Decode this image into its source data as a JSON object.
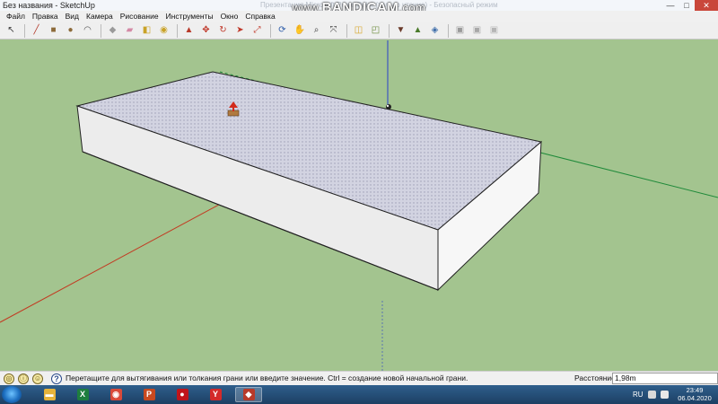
{
  "window": {
    "title": "Без названия - SketchUp",
    "faded_caption": "Презентация Microsoft PowerPoint (только чтение) - Безопасный режим",
    "controls": {
      "minimize": "—",
      "maximize": "□",
      "close": "✕"
    }
  },
  "watermark": {
    "prefix": "www.",
    "brand": "BANDICAM",
    "suffix": ".com"
  },
  "menu": [
    "Файл",
    "Правка",
    "Вид",
    "Камера",
    "Рисование",
    "Инструменты",
    "Окно",
    "Справка"
  ],
  "toolbar": {
    "tools": [
      {
        "name": "select-tool",
        "glyph": "↖",
        "color": "#3a3a3a"
      },
      {
        "name": "line-tool",
        "glyph": "╱",
        "color": "#b33a2a"
      },
      {
        "name": "rectangle-tool",
        "glyph": "■",
        "color": "#8c6a3a"
      },
      {
        "name": "circle-tool",
        "glyph": "●",
        "color": "#8c6a3a"
      },
      {
        "name": "arc-tool",
        "glyph": "◠",
        "color": "#555555"
      },
      {
        "name": "make-component-tool",
        "glyph": "◆",
        "color": "#9a9a9a"
      },
      {
        "name": "eraser-tool",
        "glyph": "▰",
        "color": "#d48aa6"
      },
      {
        "name": "tape-measure-tool",
        "glyph": "◧",
        "color": "#c9a227"
      },
      {
        "name": "paint-bucket-tool",
        "glyph": "◉",
        "color": "#c9a227"
      },
      {
        "name": "push-pull-tool",
        "glyph": "▲",
        "color": "#b83a2a"
      },
      {
        "name": "move-tool",
        "glyph": "✥",
        "color": "#c0392b"
      },
      {
        "name": "rotate-tool",
        "glyph": "↻",
        "color": "#c0392b"
      },
      {
        "name": "follow-me-tool",
        "glyph": "➤",
        "color": "#c0392b"
      },
      {
        "name": "scale-tool",
        "glyph": "⤢",
        "color": "#c0392b"
      },
      {
        "name": "orbit-tool",
        "glyph": "⟳",
        "color": "#2a5aa8"
      },
      {
        "name": "pan-tool",
        "glyph": "✋",
        "color": "#5a5a5a"
      },
      {
        "name": "zoom-tool",
        "glyph": "⌕",
        "color": "#3a3a3a"
      },
      {
        "name": "zoom-extents-tool",
        "glyph": "⤧",
        "color": "#3a3a3a"
      },
      {
        "name": "section-plane-tool",
        "glyph": "◫",
        "color": "#d6a52a"
      },
      {
        "name": "add-location-tool",
        "glyph": "◰",
        "color": "#6a8a3a"
      },
      {
        "name": "get-models-tool",
        "glyph": "▼",
        "color": "#6a3a2a"
      },
      {
        "name": "share-model-tool",
        "glyph": "▲",
        "color": "#4a7a2a"
      },
      {
        "name": "extension-warehouse-tool",
        "glyph": "◈",
        "color": "#3a6aa8"
      },
      {
        "name": "style-tool-1",
        "glyph": "▣",
        "color": "#9a9a9a"
      },
      {
        "name": "style-tool-2",
        "glyph": "▣",
        "color": "#a8a8a8"
      },
      {
        "name": "style-tool-3",
        "glyph": "▣",
        "color": "#b5b5b5"
      }
    ]
  },
  "colors": {
    "background": "#a3c48f",
    "box_top": "#d6d7e3",
    "box_front": "#eaeaea",
    "box_side": "#f5f5f5",
    "axis_red": "#c23b22",
    "axis_green": "#1f8a3a",
    "axis_blue": "#2a40c8"
  },
  "status": {
    "hint": "Перетащите для вытягивания или толкания грани или введите значение.  Ctrl = создание новой начальной грани.",
    "measure_label": "Расстояние",
    "measure_value": "1,98m"
  },
  "taskbar": {
    "apps": [
      {
        "name": "explorer",
        "glyph": "▬",
        "color": "#e6b33a"
      },
      {
        "name": "excel",
        "glyph": "X",
        "color": "#1e7e3e"
      },
      {
        "name": "chrome",
        "glyph": "◉",
        "color": "#d94a3a"
      },
      {
        "name": "powerpoint",
        "glyph": "P",
        "color": "#c8491f"
      },
      {
        "name": "bandicam",
        "glyph": "●",
        "color": "#c0141a"
      },
      {
        "name": "yandex-browser",
        "glyph": "Y",
        "color": "#d42a2a"
      },
      {
        "name": "sketchup",
        "glyph": "◆",
        "color": "#b83a2a"
      }
    ],
    "lang": "RU",
    "time": "23:49",
    "date": "06.04.2020"
  }
}
